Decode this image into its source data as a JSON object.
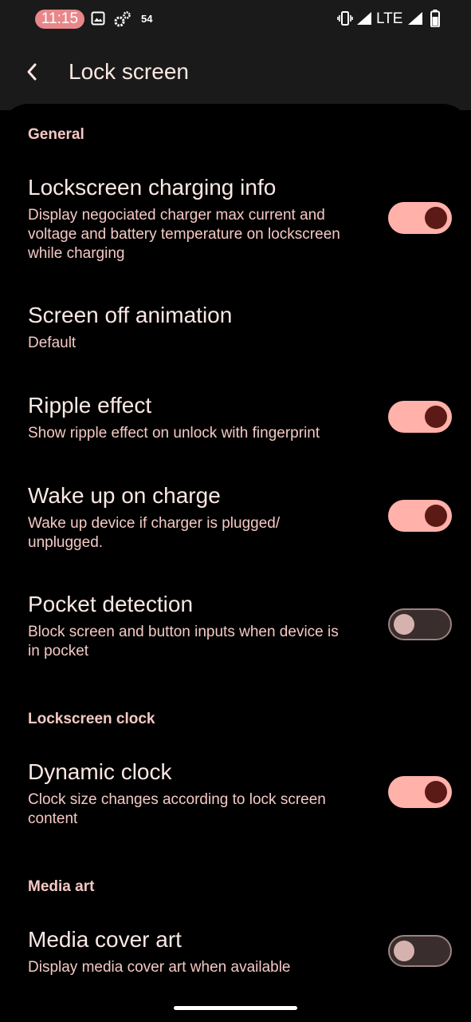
{
  "status_bar": {
    "time": "11:15",
    "notification_count": "54",
    "network": "LTE"
  },
  "header": {
    "title": "Lock screen"
  },
  "sections": {
    "general": "General",
    "lockscreen_clock": "Lockscreen clock",
    "media_art": "Media art"
  },
  "prefs": {
    "charging_info": {
      "title": "Lockscreen charging info",
      "summary_lines": [
        "Display negociated charger max current and",
        "voltage and battery temperature on lockscreen",
        "while charging"
      ],
      "enabled": true
    },
    "screen_off_animation": {
      "title": "Screen off animation",
      "summary": "Default"
    },
    "ripple_effect": {
      "title": "Ripple effect",
      "summary": "Show ripple effect on unlock with fingerprint",
      "enabled": true
    },
    "wake_on_charge": {
      "title": "Wake up on charge",
      "summary_lines": [
        "Wake up device if charger is plugged/",
        "unplugged."
      ],
      "enabled": true
    },
    "pocket_detection": {
      "title": "Pocket detection",
      "summary_lines": [
        "Block screen and button inputs when device is",
        "in pocket"
      ],
      "enabled": false
    },
    "dynamic_clock": {
      "title": "Dynamic clock",
      "summary_lines": [
        "Clock size changes according to lock screen",
        "content"
      ],
      "enabled": true
    },
    "media_cover_art": {
      "title": "Media cover art",
      "summary": "Display media cover art when available",
      "enabled": false
    }
  },
  "colors": {
    "accent": "#ffb1aa",
    "thumb_on": "#5b1a16",
    "background": "#000000",
    "header_bg": "#1a1a1a"
  }
}
